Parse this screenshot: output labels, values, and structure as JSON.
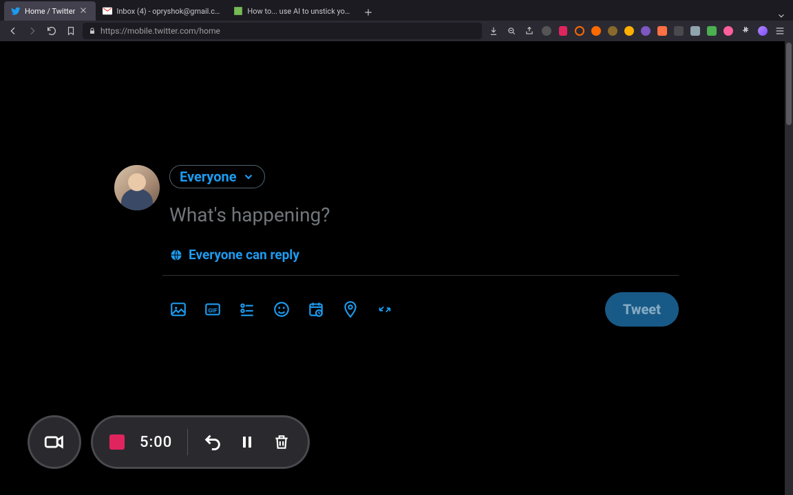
{
  "browser": {
    "tabs": [
      {
        "label": "Home / Twitter",
        "active": true
      },
      {
        "label": "Inbox (4) - opryshok@gmail.com - G",
        "active": false
      },
      {
        "label": "How to... use AI to unstick yourself",
        "active": false
      }
    ],
    "url_display": "https://mobile.twitter.com/home"
  },
  "compose": {
    "audience_label": "Everyone",
    "placeholder": "What's happening?",
    "reply_label": "Everyone can reply",
    "tweet_button": "Tweet"
  },
  "recorder": {
    "time": "5:00"
  }
}
